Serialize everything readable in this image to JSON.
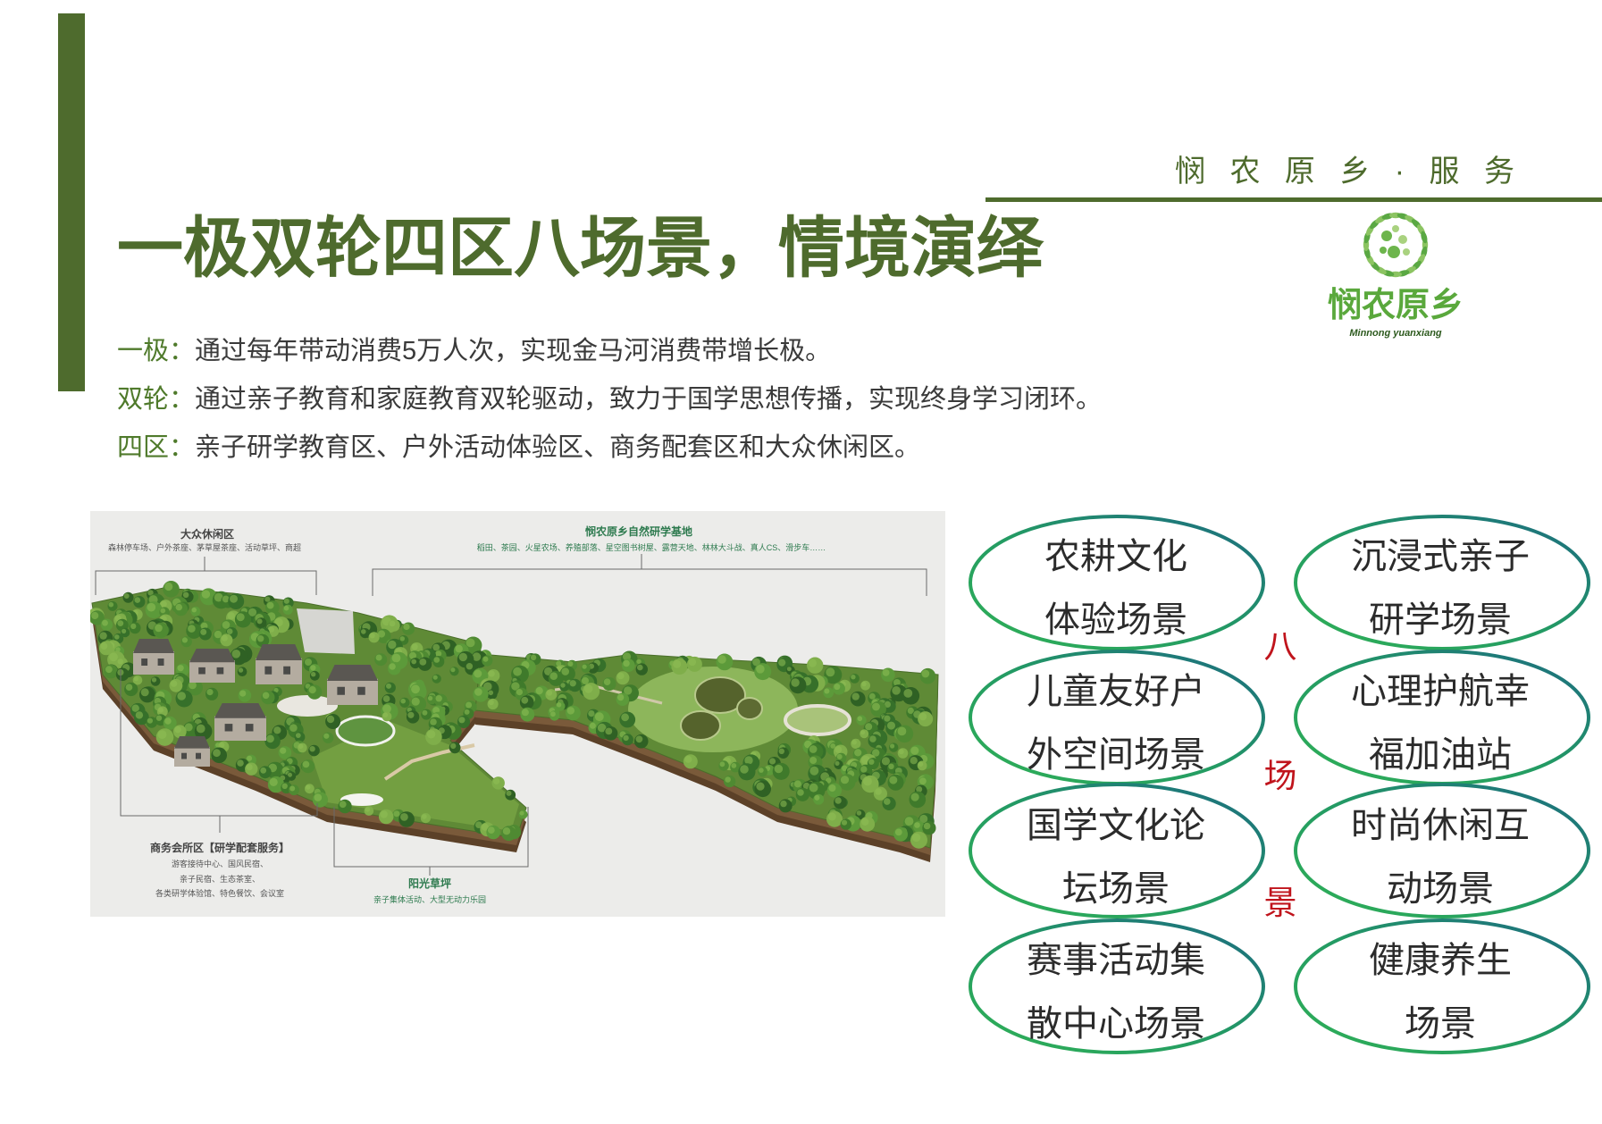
{
  "header": {
    "brand_service": "悯 农 原 乡 · 服 务"
  },
  "title": "一极双轮四区八场景，情境演绎",
  "logo": {
    "name_cn": "悯农原乡",
    "name_en": "Minnong yuanxiang",
    "icon": "leaf-wreath-icon"
  },
  "intro": [
    {
      "label": "一极：",
      "text": "通过每年带动消费5万人次，实现金马河消费带增长极。"
    },
    {
      "label": "双轮：",
      "text": "通过亲子教育和家庭教育双轮驱动，致力于国学思想传播，实现终身学习闭环。"
    },
    {
      "label": "四区：",
      "text": "亲子研学教育区、户外活动体验区、商务配套区和大众休闲区。"
    }
  ],
  "map": {
    "leisure": {
      "title": "大众休闲区",
      "detail": "森林停车场、户外茶座、茅草屋茶座、活动草坪、商超"
    },
    "base": {
      "title": "悯农原乡自然研学基地",
      "detail": "稻田、茶园、火星农场、养殖部落、星空图书树屋、露营天地、林林大斗战、真人CS、滑步车……"
    },
    "business": {
      "title": "商务会所区【研学配套服务】",
      "detail_lines": [
        "游客接待中心、国风民宿、",
        "亲子民宿、生态茶室、",
        "各类研学体验馆、特色餐饮、会议室"
      ]
    },
    "lawn": {
      "title": "阳光草坪",
      "detail": "亲子集体活动、大型无动力乐园"
    }
  },
  "scenes": {
    "side_label": [
      "八",
      "场",
      "景"
    ],
    "items": [
      {
        "lines": [
          "农耕文化",
          "体验场景"
        ]
      },
      {
        "lines": [
          "沉浸式亲子",
          "研学场景"
        ]
      },
      {
        "lines": [
          "儿童友好户",
          "外空间场景"
        ]
      },
      {
        "lines": [
          "心理护航幸",
          "福加油站"
        ]
      },
      {
        "lines": [
          "国学文化论",
          "坛场景"
        ]
      },
      {
        "lines": [
          "时尚休闲互",
          "动场景"
        ]
      },
      {
        "lines": [
          "赛事活动集",
          "散中心场景"
        ]
      },
      {
        "lines": [
          "健康养生",
          "场景"
        ]
      }
    ]
  },
  "colors": {
    "primary_green": "#4e6b2d",
    "scene_red": "#c0141c",
    "ring_start": "#2fb056",
    "ring_end": "#1c6a82"
  }
}
